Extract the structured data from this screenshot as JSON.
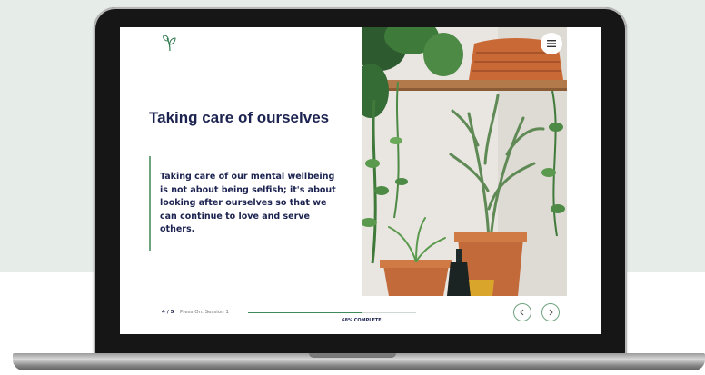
{
  "slide": {
    "title": "Taking care of ourselves",
    "quote": "Taking care of our mental wellbeing is not about being selfish; it's about looking after ourselves so that we can continue to love and serve others."
  },
  "footer": {
    "page_indicator": "4 / 5",
    "session_label": "Press On: Session 1",
    "progress_percent": 68,
    "progress_label": "68% COMPLETE"
  },
  "icons": {
    "logo": "leaf-logo-icon",
    "menu": "hamburger-menu-icon",
    "prev": "chevron-left-icon",
    "next": "chevron-right-icon"
  },
  "colors": {
    "title": "#1c2350",
    "accent": "#6fa37f",
    "progress": "#3f8a5a"
  }
}
